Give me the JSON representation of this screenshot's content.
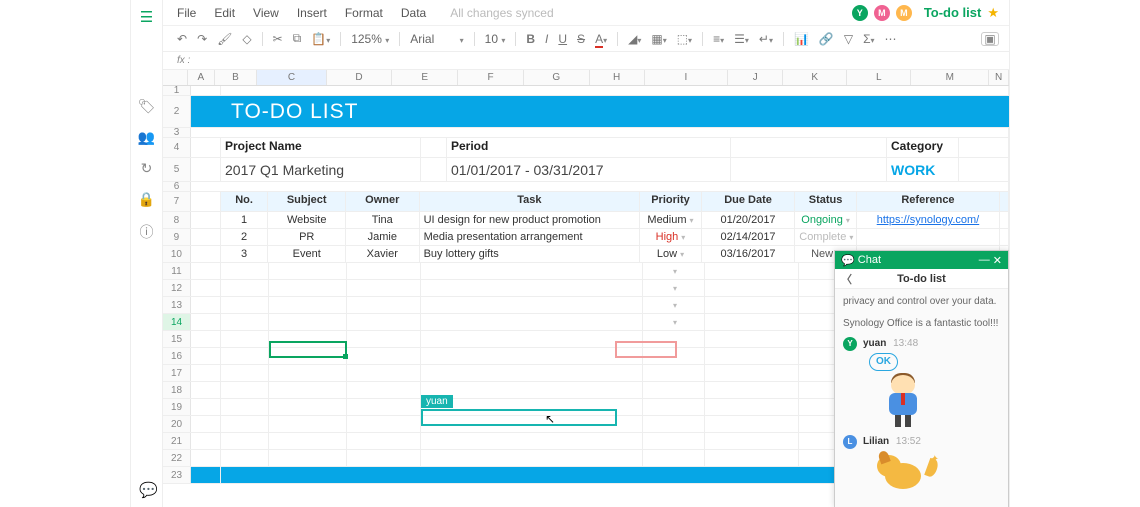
{
  "menubar": {
    "items": [
      "File",
      "Edit",
      "View",
      "Insert",
      "Format",
      "Data"
    ],
    "sync": "All changes synced"
  },
  "avatars": [
    {
      "letter": "Y",
      "color": "#0aa560"
    },
    {
      "letter": "M",
      "color": "#f06292"
    },
    {
      "letter": "M",
      "color": "#ffb74d"
    }
  ],
  "doc_title": "To-do list",
  "toolbar": {
    "zoom": "125%",
    "font": "Arial",
    "size": "10"
  },
  "fx_label": "fx",
  "columns": [
    "A",
    "B",
    "C",
    "D",
    "E",
    "F",
    "G",
    "H",
    "I",
    "J",
    "K",
    "L",
    "M",
    "N"
  ],
  "banner": "TO-DO LIST",
  "headers4": {
    "project": "Project Name",
    "period": "Period",
    "category": "Category"
  },
  "row5": {
    "project": "2017 Q1 Marketing",
    "period": "01/01/2017 - 03/31/2017",
    "category": "WORK"
  },
  "tbl_headers": [
    "No.",
    "Subject",
    "Owner",
    "Task",
    "Priority",
    "Due Date",
    "Status",
    "Reference"
  ],
  "rows": [
    {
      "no": "1",
      "subject": "Website",
      "owner": "Tina",
      "task": "UI design for new product promotion",
      "priority": "Medium",
      "pclass": "pri-med",
      "due": "01/20/2017",
      "status": "Ongoing",
      "sclass": "st-ongoing",
      "ref": "https://synology.com/"
    },
    {
      "no": "2",
      "subject": "PR",
      "owner": "Jamie",
      "task": "Media presentation arrangement",
      "priority": "High",
      "pclass": "pri-high",
      "due": "02/14/2017",
      "status": "Complete",
      "sclass": "st-complete",
      "ref": ""
    },
    {
      "no": "3",
      "subject": "Event",
      "owner": "Xavier",
      "task": "Buy lottery gifts",
      "priority": "Low",
      "pclass": "pri-low",
      "due": "03/16/2017",
      "status": "New",
      "sclass": "st-new",
      "ref": ""
    }
  ],
  "collab_tag": "yuan",
  "chat": {
    "header": "Chat",
    "title": "To-do list",
    "line1": "privacy and control over your data.",
    "line2": "Synology Office is a fantastic tool!!!",
    "msgs": [
      {
        "name": "yuan",
        "time": "13:48",
        "av": "Y",
        "color": "#0aa560"
      },
      {
        "name": "Lilian",
        "time": "13:52",
        "av": "L",
        "color": "#4a90e2"
      }
    ],
    "ok": "OK"
  }
}
